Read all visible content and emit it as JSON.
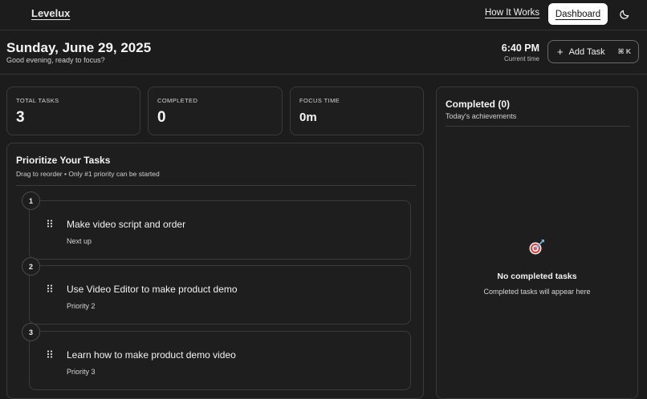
{
  "nav": {
    "logo": "Levelux",
    "how_it_works": "How It Works",
    "dashboard": "Dashboard",
    "theme_icon": "moon-icon"
  },
  "header": {
    "date": "Sunday, June 29, 2025",
    "greeting": "Good evening, ready to focus?",
    "time": "6:40 PM",
    "time_label": "Current time",
    "add_task_label": "Add Task",
    "add_task_shortcut": "⌘ K"
  },
  "stats": [
    {
      "label": "TOTAL TASKS",
      "value": "3"
    },
    {
      "label": "COMPLETED",
      "value": "0"
    },
    {
      "label": "FOCUS TIME",
      "value": "0m"
    }
  ],
  "prioritize": {
    "title": "Prioritize Your Tasks",
    "subtitle": "Drag to reorder • Only #1 priority can be started",
    "tasks": [
      {
        "rank": "1",
        "title": "Make video script and order",
        "meta": "Next up"
      },
      {
        "rank": "2",
        "title": "Use Video Editor to make product demo",
        "meta": "Priority 2"
      },
      {
        "rank": "3",
        "title": "Learn how to make product demo video",
        "meta": "Priority 3"
      }
    ]
  },
  "completed": {
    "title": "Completed (0)",
    "subtitle": "Today's achievements",
    "empty_icon": "target-icon",
    "empty_title": "No completed tasks",
    "empty_subtitle": "Completed tasks will appear here"
  },
  "colors": {
    "background": "#1c1c1c",
    "card": "#1e1e1e",
    "border": "#3a3a3a",
    "accent_target": "#e23b3b"
  }
}
